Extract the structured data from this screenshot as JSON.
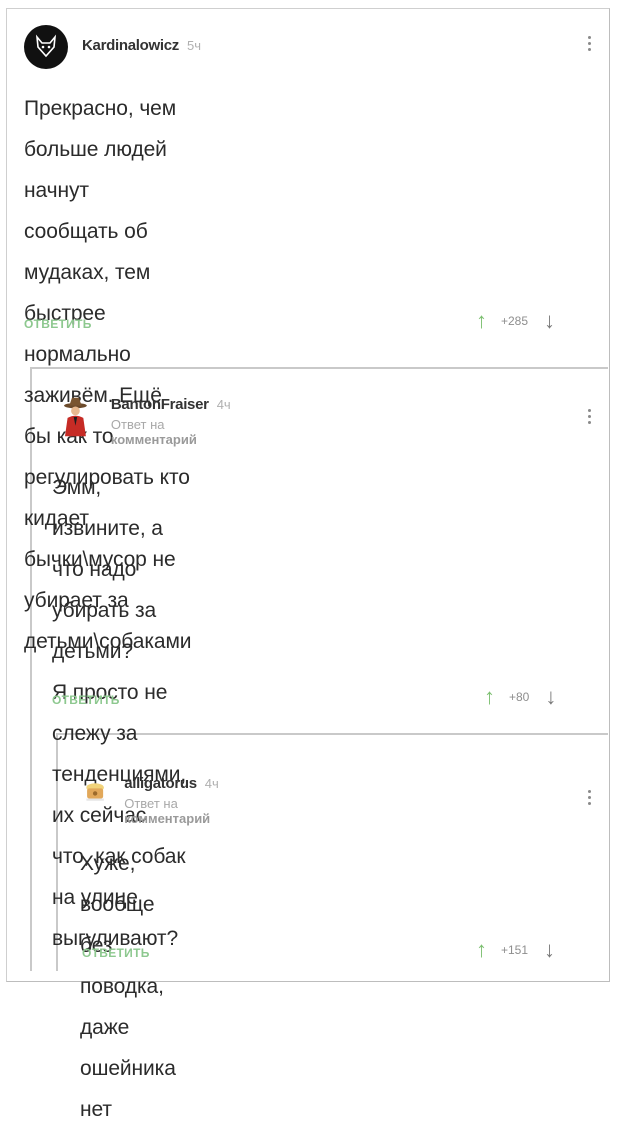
{
  "comments": [
    {
      "username": "Kardinalowicz",
      "time": "5ч",
      "text": "Прекрасно, чем больше людей начнут\nсообщать об мудаках, тем быстрее\nнормально заживём. Ещё бы как то\nрегулировать кто кидает бычки\\мусор не\nубирает за детьми\\собаками",
      "reply_label": "ОТВЕТИТЬ",
      "rating": "+285"
    },
    {
      "username": "BantonFraiser",
      "time": "4ч",
      "subtitle_prefix": "Ответ на",
      "subtitle_link": "комментарий",
      "text": "Эмм, извините, а что надо убирать за\nдетьми?\nЯ просто не слежу за тенденциями,\nих сейчас что, как собак на улице\nвыгуливают?",
      "reply_label": "ОТВЕТИТЬ",
      "rating": "+80"
    },
    {
      "username": "alligatorus",
      "time": "4ч",
      "subtitle_prefix": "Ответ на",
      "subtitle_link": "комментарий",
      "text": "Хуже, вообще без поводка, даже\nошейника нет",
      "reply_label": "ОТВЕТИТЬ",
      "rating": "+151"
    }
  ],
  "colors": {
    "reply": "#8dc88f",
    "upvote": "#7cbf70",
    "thread_line": "#c9c9c9"
  },
  "icons": {
    "up": "arrow-up-icon",
    "down": "arrow-down-icon",
    "menu": "more-vertical-icon"
  }
}
